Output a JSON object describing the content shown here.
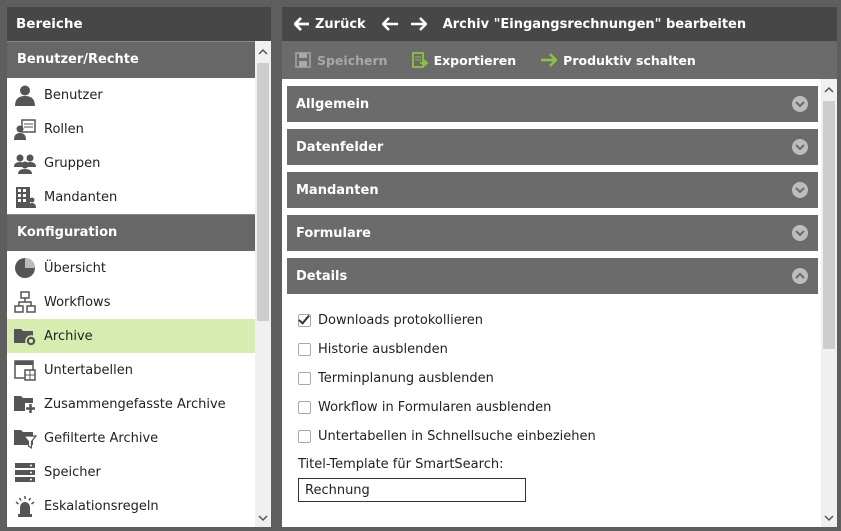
{
  "left_panel": {
    "header": "Bereiche",
    "sections": [
      {
        "title": "Benutzer/Rechte",
        "items": [
          {
            "label": "Benutzer",
            "icon": "user-icon"
          },
          {
            "label": "Rollen",
            "icon": "roles-icon"
          },
          {
            "label": "Gruppen",
            "icon": "group-icon"
          },
          {
            "label": "Mandanten",
            "icon": "building-icon"
          }
        ]
      },
      {
        "title": "Konfiguration",
        "items": [
          {
            "label": "Übersicht",
            "icon": "pie-chart-icon"
          },
          {
            "label": "Workflows",
            "icon": "workflow-icon"
          },
          {
            "label": "Archive",
            "icon": "archive-folder-icon",
            "active": true
          },
          {
            "label": "Untertabellen",
            "icon": "subtable-icon"
          },
          {
            "label": "Zusammengefasste Archive",
            "icon": "folder-plus-icon"
          },
          {
            "label": "Gefilterte Archive",
            "icon": "filter-folder-icon"
          },
          {
            "label": "Speicher",
            "icon": "storage-icon"
          },
          {
            "label": "Eskalationsregeln",
            "icon": "alarm-icon"
          }
        ]
      }
    ]
  },
  "topbar": {
    "back_label": "Zurück",
    "title": "Archiv \"Eingangsrechnungen\" bearbeiten"
  },
  "toolbar": {
    "save_label": "Speichern",
    "export_label": "Exportieren",
    "productive_label": "Produktiv schalten"
  },
  "accordions": [
    {
      "label": "Allgemein",
      "expanded": false
    },
    {
      "label": "Datenfelder",
      "expanded": false
    },
    {
      "label": "Mandanten",
      "expanded": false
    },
    {
      "label": "Formulare",
      "expanded": false
    },
    {
      "label": "Details",
      "expanded": true
    }
  ],
  "details": {
    "checkboxes": [
      {
        "label": "Downloads protokollieren",
        "checked": true
      },
      {
        "label": "Historie ausblenden",
        "checked": false
      },
      {
        "label": "Terminplanung ausblenden",
        "checked": false
      },
      {
        "label": "Workflow in Formularen ausblenden",
        "checked": false
      },
      {
        "label": "Untertabellen in Schnellsuche einbeziehen",
        "checked": false
      }
    ],
    "title_template_label": "Titel-Template für SmartSearch:",
    "title_template_value": "Rechnung"
  },
  "colors": {
    "active_item": "#d6ecb0",
    "accent_green": "#8cc43f",
    "header_dark": "#474747",
    "section_gray": "#676767"
  }
}
